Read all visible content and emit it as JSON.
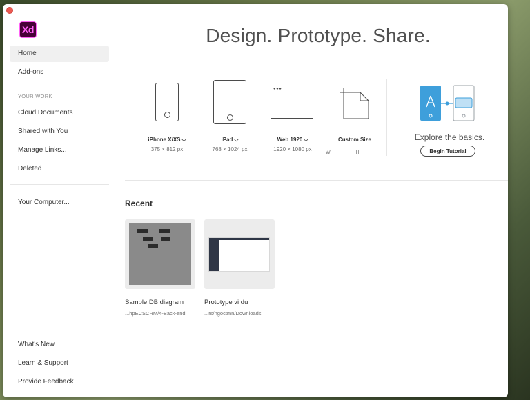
{
  "app": {
    "logo_text": "Xd",
    "headline": "Design. Prototype. Share."
  },
  "sidebar": {
    "primary": [
      {
        "label": "Home",
        "active": true
      },
      {
        "label": "Add-ons",
        "active": false
      }
    ],
    "section_label": "YOUR WORK",
    "work": [
      {
        "label": "Cloud Documents"
      },
      {
        "label": "Shared with You"
      },
      {
        "label": "Manage Links..."
      },
      {
        "label": "Deleted"
      }
    ],
    "local": {
      "label": "Your Computer..."
    },
    "bottom": [
      {
        "label": "What's New"
      },
      {
        "label": "Learn & Support"
      },
      {
        "label": "Provide Feedback"
      }
    ]
  },
  "presets": [
    {
      "name": "iPhone X/XS",
      "dims": "375 × 812 px",
      "icon": "phone-icon"
    },
    {
      "name": "iPad",
      "dims": "768 × 1024 px",
      "icon": "tablet-icon"
    },
    {
      "name": "Web 1920",
      "dims": "1920 × 1080 px",
      "icon": "browser-icon"
    },
    {
      "name": "Custom Size",
      "w_label": "W",
      "h_label": "H",
      "w_value": "",
      "h_value": "",
      "icon": "custom-size-icon"
    }
  ],
  "explore": {
    "text": "Explore the basics.",
    "button": "Begin Tutorial",
    "accent": "#3e9fdb"
  },
  "recent": {
    "title": "Recent",
    "items": [
      {
        "title": "Sample DB diagram",
        "path": "...hpECSCRM/4-Back-end"
      },
      {
        "title": "Prototype vi du",
        "path": "...rs/ngoctmn/Downloads"
      }
    ]
  },
  "colors": {
    "close": "#ee5a52",
    "logo_bg": "#470137",
    "logo_fg": "#ff61f6"
  }
}
